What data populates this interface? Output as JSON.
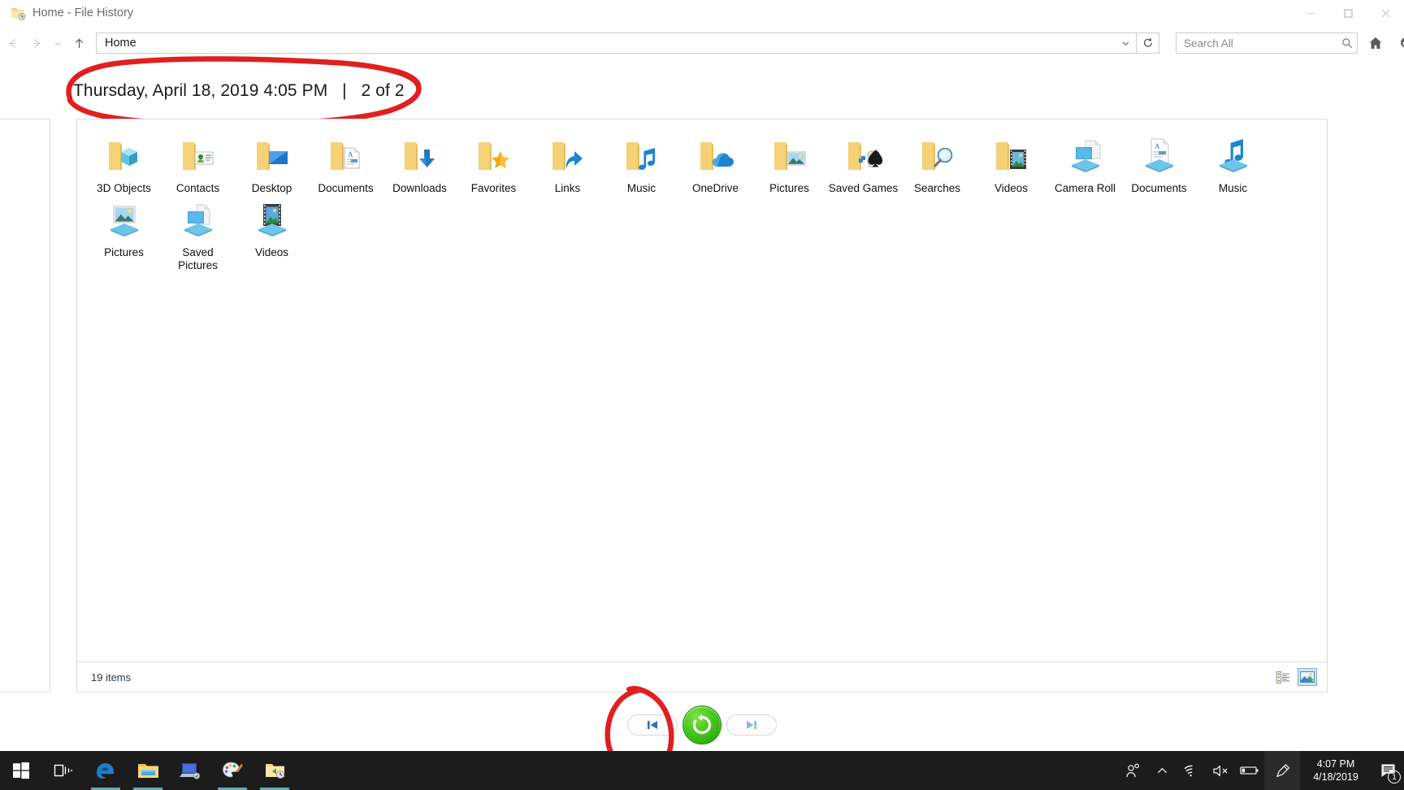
{
  "window": {
    "title": "Home - File History",
    "icon": "file-history-folder-icon",
    "minimize_label": "—",
    "maximize_label": "☐",
    "close_label": "✕"
  },
  "addressbar": {
    "back_label": "←",
    "forward_label": "→",
    "recent_label": "⌄",
    "up_label": "↑",
    "path_value": "Home",
    "dropdown_label": "⌄",
    "refresh_label": "↻",
    "home_label": "home-icon",
    "settings_label": "gear-icon"
  },
  "search": {
    "placeholder": "Search All",
    "icon": "search-icon"
  },
  "backup": {
    "date_line": "Thursday, April 18, 2019 4:05 PM   |   2 of 2",
    "timestamp": "Thursday, April 18, 2019 4:05 PM",
    "separator": "|",
    "position": "2 of 2"
  },
  "items": [
    {
      "label": "3D Objects",
      "icon": "folder-3d-objects-icon"
    },
    {
      "label": "Contacts",
      "icon": "folder-contacts-icon"
    },
    {
      "label": "Desktop",
      "icon": "folder-desktop-icon"
    },
    {
      "label": "Documents",
      "icon": "folder-documents-icon"
    },
    {
      "label": "Downloads",
      "icon": "folder-downloads-icon"
    },
    {
      "label": "Favorites",
      "icon": "folder-favorites-icon"
    },
    {
      "label": "Links",
      "icon": "folder-links-icon"
    },
    {
      "label": "Music",
      "icon": "folder-music-icon"
    },
    {
      "label": "OneDrive",
      "icon": "folder-onedrive-icon"
    },
    {
      "label": "Pictures",
      "icon": "folder-pictures-icon"
    },
    {
      "label": "Saved Games",
      "icon": "folder-saved-games-icon"
    },
    {
      "label": "Searches",
      "icon": "folder-searches-icon"
    },
    {
      "label": "Videos",
      "icon": "folder-videos-icon"
    },
    {
      "label": "Camera Roll",
      "icon": "library-camera-roll-icon"
    },
    {
      "label": "Documents",
      "icon": "library-documents-icon"
    },
    {
      "label": "Music",
      "icon": "library-music-icon"
    },
    {
      "label": "Pictures",
      "icon": "library-pictures-icon"
    },
    {
      "label": "Saved Pictures",
      "icon": "library-saved-pictures-icon"
    },
    {
      "label": "Videos",
      "icon": "library-videos-icon"
    }
  ],
  "statusbar": {
    "count_text": "19 items",
    "details_view": "details-view-icon",
    "large_icons_view": "large-icons-view-icon"
  },
  "navcontrols": {
    "previous_label": "previous-version-icon",
    "restore_label": "restore-icon",
    "next_label": "next-version-icon"
  },
  "annotations": [
    {
      "name": "date-circle",
      "color": "#e02020",
      "shape": "ellipse-handdrawn"
    },
    {
      "name": "previous-button-circle",
      "color": "#e02020",
      "shape": "ellipse-handdrawn"
    }
  ],
  "taskbar": {
    "items": [
      {
        "name": "start-button",
        "icon": "windows-logo-icon",
        "active": false
      },
      {
        "name": "task-view-button",
        "icon": "task-view-icon",
        "active": false
      },
      {
        "name": "edge-button",
        "icon": "edge-icon",
        "active": true
      },
      {
        "name": "file-explorer-button",
        "icon": "file-explorer-icon",
        "active": true
      },
      {
        "name": "this-pc-button",
        "icon": "this-pc-icon",
        "active": false
      },
      {
        "name": "paint-button",
        "icon": "paint-icon",
        "active": true
      },
      {
        "name": "file-history-button",
        "icon": "file-history-icon",
        "active": true
      }
    ],
    "tray": [
      {
        "name": "people-icon",
        "glyph": "people"
      },
      {
        "name": "show-hidden-icons-icon",
        "glyph": "chevron-up"
      },
      {
        "name": "network-icon",
        "glyph": "wifi"
      },
      {
        "name": "volume-muted-icon",
        "glyph": "speaker-mute"
      },
      {
        "name": "battery-icon",
        "glyph": "battery"
      },
      {
        "name": "pen-workspace-icon",
        "glyph": "pen"
      }
    ],
    "clock": {
      "time": "4:07 PM",
      "date": "4/18/2019"
    },
    "notifications": {
      "icon": "action-center-icon",
      "count": "1"
    }
  },
  "colors": {
    "accent_green": "#3dbb12",
    "annotation_red": "#e02020",
    "folder_yellow": "#f7d070",
    "library_blue": "#3ea9e0",
    "taskbar": "#1c1c1c"
  }
}
